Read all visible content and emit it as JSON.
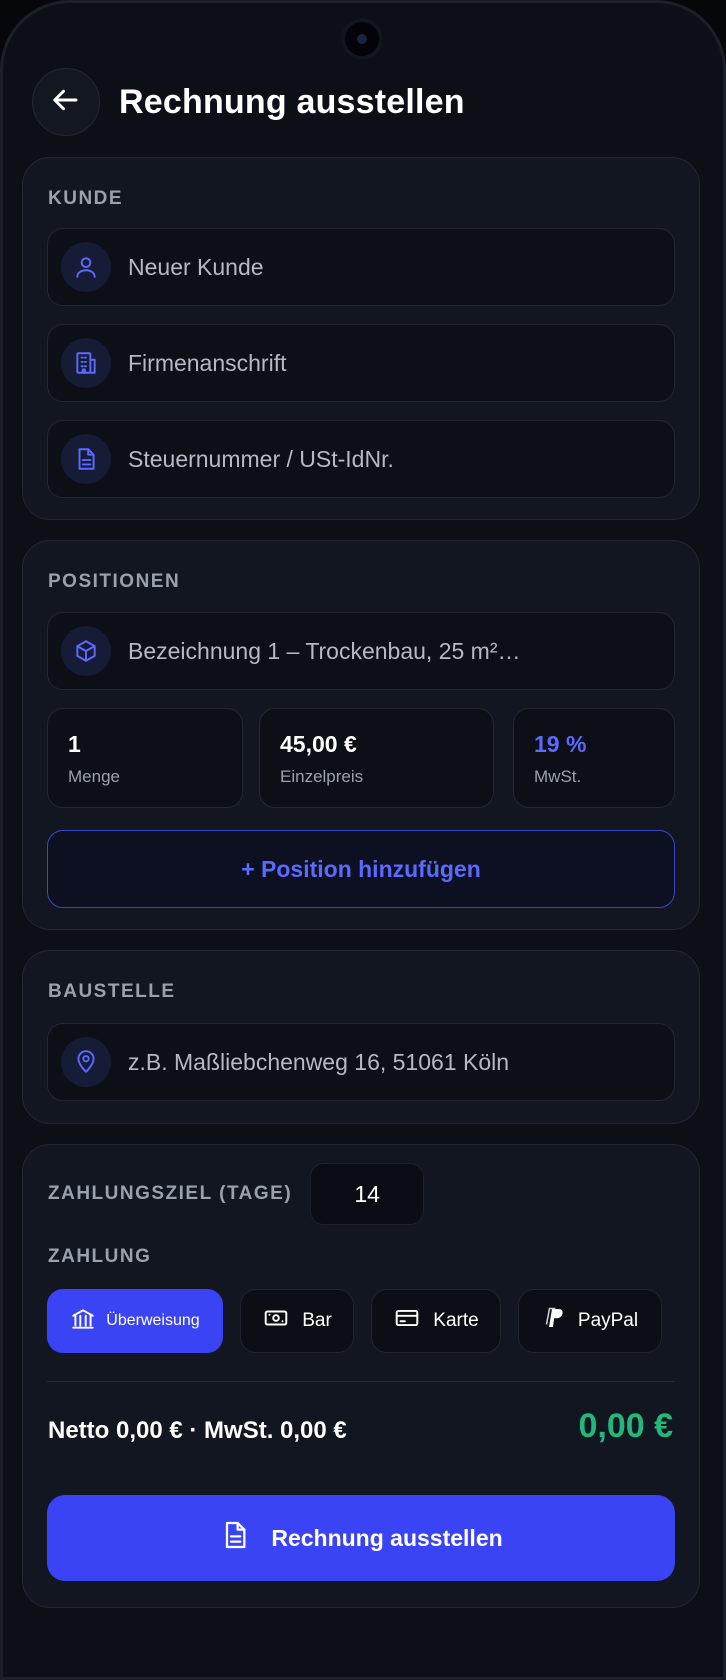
{
  "header": {
    "back_icon": "arrow-left-icon",
    "title": "Rechnung ausstellen"
  },
  "customer": {
    "section_label": "KUNDE",
    "fields": [
      {
        "icon": "user-icon",
        "placeholder": "Neuer Kunde"
      },
      {
        "icon": "building-icon",
        "placeholder": "Firmenanschrift"
      },
      {
        "icon": "document-icon",
        "placeholder": "Steuernummer / USt-IdNr."
      }
    ]
  },
  "positions": {
    "section_label": "POSITIONEN",
    "item": {
      "icon": "box-icon",
      "placeholder": "Bezeichnung 1 – Trockenbau, 25 m²…"
    },
    "quantity": {
      "value": "1",
      "label": "Menge"
    },
    "unit_price": {
      "value": "45,00 €",
      "label": "Einzelpreis"
    },
    "vat": {
      "value": "19 %",
      "label": "MwSt."
    },
    "add_button": "+ Position hinzufügen"
  },
  "site": {
    "section_label": "BAUSTELLE",
    "field": {
      "icon": "map-pin-icon",
      "placeholder": "z.B. Maßlieb­chenweg 16, 51061 Köln"
    }
  },
  "payment": {
    "term_label": "ZAHLUNGSZIEL (TAGE)",
    "term_value": "14",
    "section_label": "ZAHLUNG",
    "methods": [
      {
        "icon": "bank-icon",
        "label": "Überweisung",
        "selected": true
      },
      {
        "icon": "banknote-icon",
        "label": "Bar",
        "selected": false
      },
      {
        "icon": "credit-card-icon",
        "label": "Karte",
        "selected": false
      },
      {
        "icon": "paypal-icon",
        "label": "PayPal",
        "selected": false
      }
    ]
  },
  "totals": {
    "summary": "Netto 0,00 € · MwSt. 0,00 €",
    "total": "0,00 €"
  },
  "submit": {
    "icon": "document-icon",
    "label": "Rechnung ausstellen"
  },
  "colors": {
    "accent": "#3a44f5",
    "accent_text": "#5b69ff",
    "total_green": "#22b87a",
    "background": "#0c0f15",
    "card": "#121620"
  }
}
